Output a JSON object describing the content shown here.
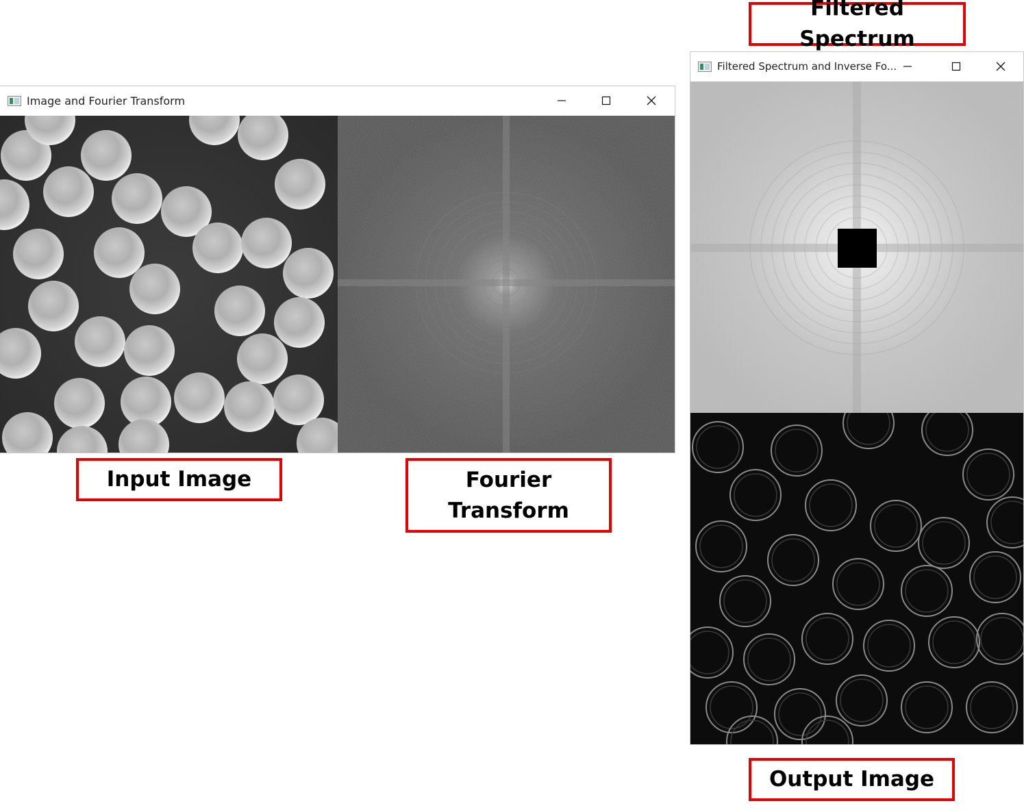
{
  "window_left": {
    "title": "Image and Fourier Transform",
    "panes": {
      "left": "input image",
      "right": "fourier spectrum"
    }
  },
  "window_right": {
    "title": "Filtered Spectrum and Inverse Fo...",
    "panes": {
      "top": "filtered spectrum",
      "bottom": "output image"
    }
  },
  "window_controls": {
    "minimize": "minimize-icon",
    "maximize": "maximize-icon",
    "close": "close-icon"
  },
  "callouts": {
    "filtered_spectrum": "Filtered Spectrum",
    "input_image": "Input Image",
    "fourier_transform": "Fourier\nTransform",
    "output_image": "Output Image"
  },
  "colors": {
    "callout_border": "#e60000",
    "title_bar": "#ffffff"
  }
}
